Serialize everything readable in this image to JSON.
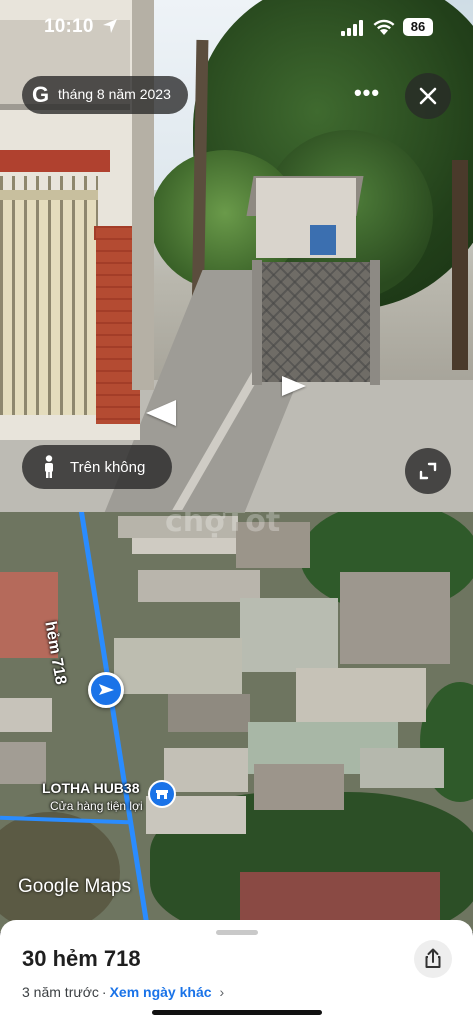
{
  "status_bar": {
    "time": "10:10",
    "battery": "86"
  },
  "street_view": {
    "date_label": "tháng 8 năm 2023",
    "google_glyph": "G",
    "more_label": "•••",
    "aerial_button_label": "Trên không"
  },
  "map": {
    "watermark": "chợTốt",
    "street_name": "hẻm 718",
    "shop_name": "LOTHA HUB38",
    "shop_category": "Cửa hàng tiện lợi",
    "attribution": "Google Maps"
  },
  "sheet": {
    "title": "30 hẻm 718",
    "age": "3 năm trước",
    "separator": "·",
    "other_dates_link": "Xem ngày khác",
    "chevron": "›"
  },
  "colors": {
    "accent_blue": "#1a73e8",
    "route_blue": "#2a8cff"
  },
  "icons": [
    "location-arrow-icon",
    "signal-icon",
    "wifi-icon",
    "google-g-icon",
    "more-icon",
    "close-icon",
    "person-icon",
    "expand-icon",
    "navigation-marker-icon",
    "shop-icon",
    "share-icon",
    "chevron-right-icon"
  ]
}
